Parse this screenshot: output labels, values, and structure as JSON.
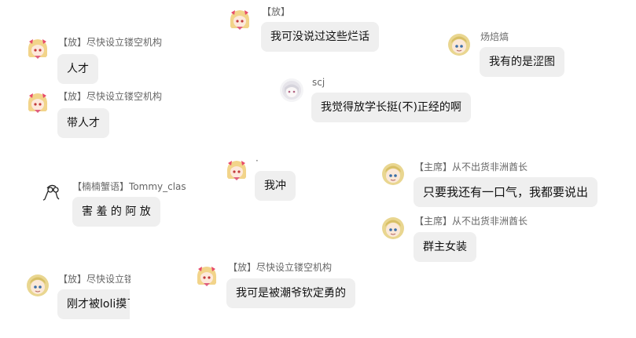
{
  "messages": [
    {
      "name": "【放】尽快设立镂空机构",
      "text": "人才"
    },
    {
      "name": "【放】尽快设立镂空机构",
      "text": "带人才"
    },
    {
      "name": "【楠楠蟹语】Tommy_clas",
      "text": "害 羞 的 阿 放"
    },
    {
      "name": "【放】尽快设立镂",
      "text": "刚才被loli摸了"
    },
    {
      "name": "【放】",
      "text": "我可没说过这些烂话"
    },
    {
      "name": "scj",
      "text": "我觉得放学长挺(不)正经的啊"
    },
    {
      "name": "·",
      "text": "我冲"
    },
    {
      "name": "【放】尽快设立镂空机构",
      "text": "我可是被潮爷钦定勇的"
    },
    {
      "name": "炀焙熇",
      "text": "我有的是涩图"
    },
    {
      "name": "【主席】从不出货非洲酋长",
      "text": "只要我还有一口气，我都要说出"
    },
    {
      "name": "【主席】从不出货非洲酋长",
      "text": "群主女装"
    }
  ],
  "avatars": {
    "fang": "blonde-anime-girl-avatar",
    "zhuxi": "blonde-boy-avatar",
    "nannan": "stick-figure-glasses-avatar",
    "scj": "pale-anime-avatar"
  },
  "colors": {
    "bubble": "#efefef",
    "name": "#666666",
    "text": "#111111"
  }
}
